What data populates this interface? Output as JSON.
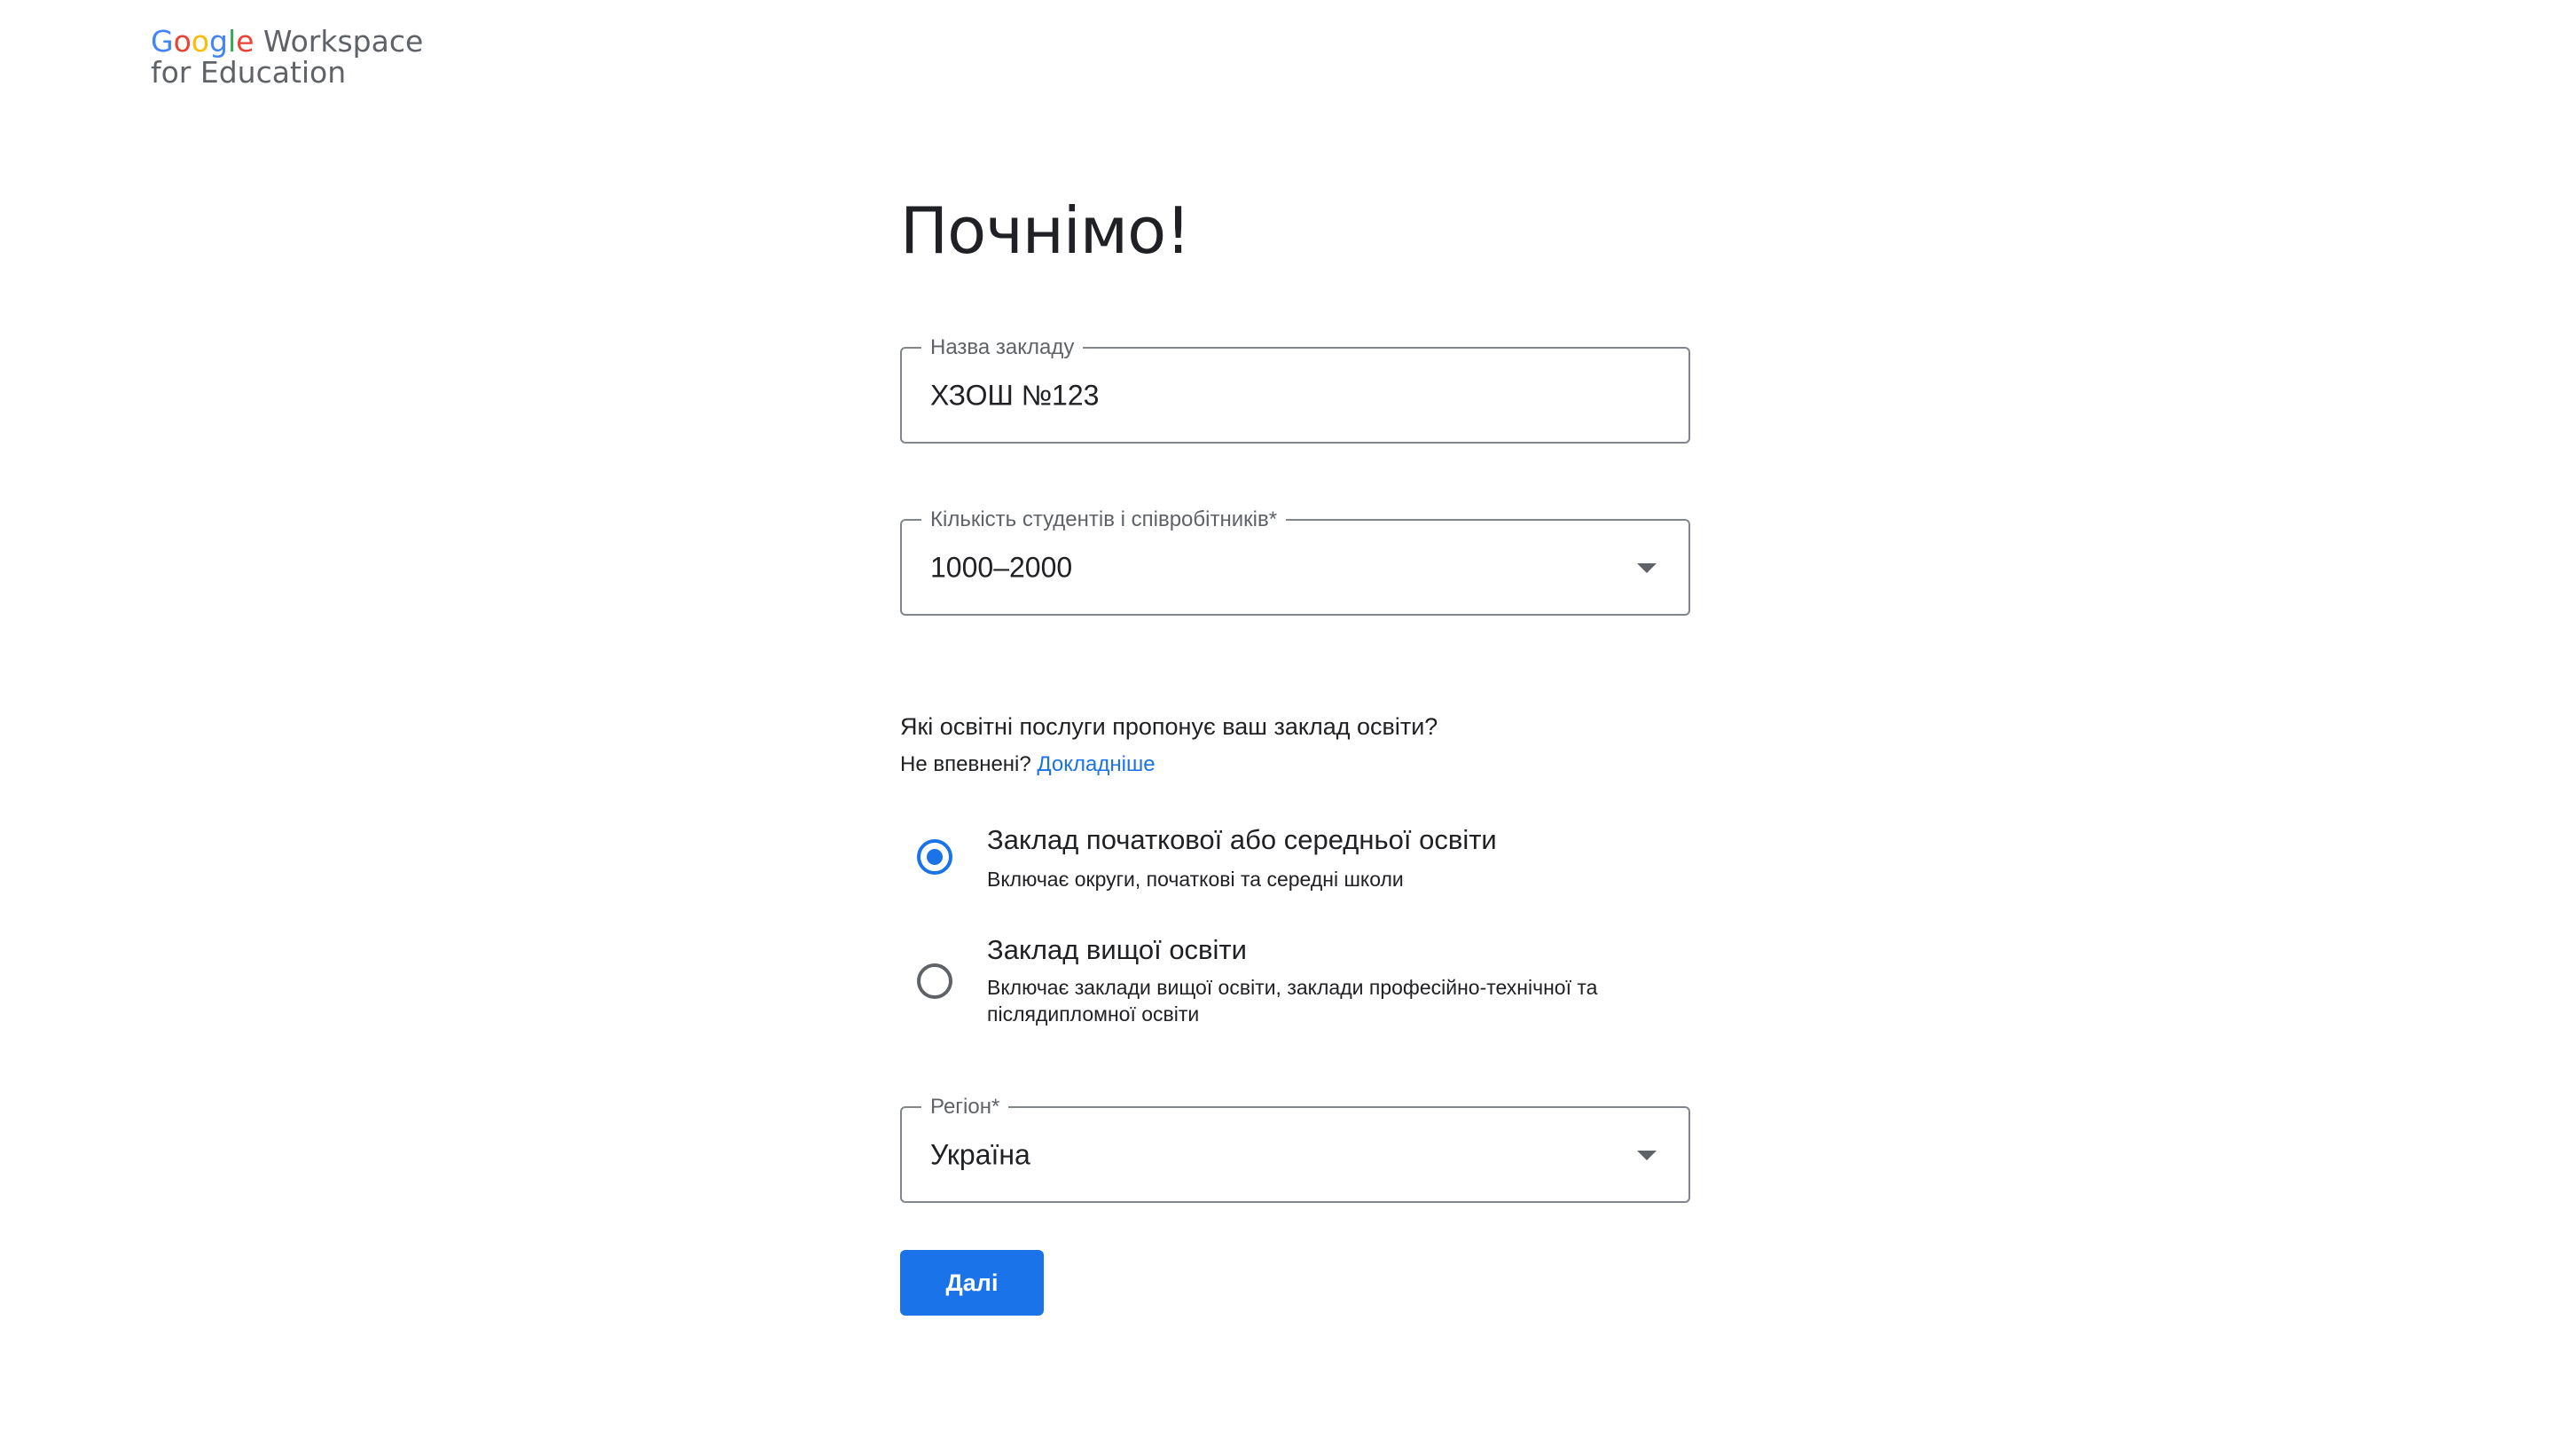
{
  "logo": {
    "brand_letters": [
      "G",
      "o",
      "o",
      "g",
      "l",
      "e"
    ],
    "product": " Workspace",
    "subtitle": "for Education"
  },
  "page": {
    "title": "Почнімо!"
  },
  "institution_name": {
    "label": "Назва закладу",
    "value": "ХЗОШ №123"
  },
  "headcount": {
    "label": "Кількість студентів і співробітників*",
    "value": "1000–2000"
  },
  "services": {
    "question": "Які освітні послуги пропонує ваш заклад освіти?",
    "hint": "Не впевнені?",
    "hint_link": "Докладніше",
    "options": [
      {
        "title": "Заклад початкової або середньої освіти",
        "description": "Включає округи, початкові та середні школи",
        "selected": true
      },
      {
        "title": "Заклад вищої освіти",
        "description": "Включає заклади вищої освіти, заклади професійно-технічної та післядипломної освіти",
        "selected": false
      }
    ]
  },
  "region": {
    "label": "Регіон*",
    "value": "Україна"
  },
  "actions": {
    "next_label": "Далі"
  },
  "colors": {
    "accent": "#1a73e8",
    "border": "#80868b",
    "text": "#202124",
    "muted": "#5f6368"
  }
}
